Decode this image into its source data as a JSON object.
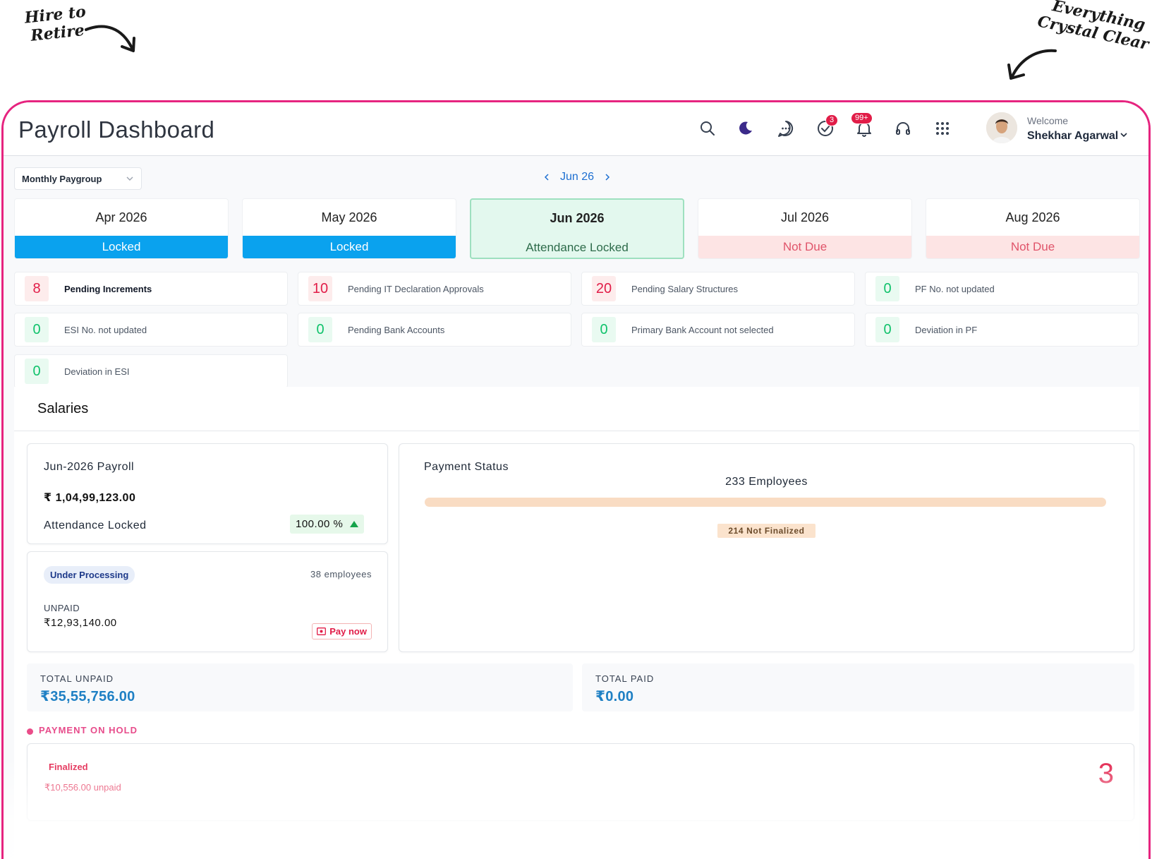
{
  "annotations": {
    "left_line1": "Hire to",
    "left_line2": "Retire",
    "right_line1": "Everything",
    "right_line2": "Crystal Clear"
  },
  "header": {
    "title": "Payroll Dashboard",
    "tasks_badge": "3",
    "notifications_badge": "99+",
    "welcome": "Welcome",
    "user_name": "Shekhar Agarwal",
    "icons": [
      "search-icon",
      "moon-icon",
      "chat-icon",
      "tasks-check-icon",
      "bell-icon",
      "headset-icon",
      "apps-grid-icon"
    ]
  },
  "controls": {
    "paygroup": "Monthly Paygroup",
    "current_month": "Jun 26"
  },
  "months": [
    {
      "name": "Apr 2026",
      "status": "Locked"
    },
    {
      "name": "May 2026",
      "status": "Locked"
    },
    {
      "name": "Jun 2026",
      "status": "Attendance Locked"
    },
    {
      "name": "Jul 2026",
      "status": "Not Due"
    },
    {
      "name": "Aug 2026",
      "status": "Not Due"
    }
  ],
  "stats": [
    {
      "value": "8",
      "label": "Pending Increments"
    },
    {
      "value": "10",
      "label": "Pending IT Declaration Approvals"
    },
    {
      "value": "20",
      "label": "Pending Salary Structures"
    },
    {
      "value": "0",
      "label": "PF No. not updated"
    },
    {
      "value": "0",
      "label": "ESI No. not updated"
    },
    {
      "value": "0",
      "label": "Pending Bank Accounts"
    },
    {
      "value": "0",
      "label": "Primary Bank Account not selected"
    },
    {
      "value": "0",
      "label": "Deviation in PF"
    },
    {
      "value": "0",
      "label": "Deviation in ESI"
    }
  ],
  "salaries": {
    "title": "Salaries",
    "payroll": {
      "title": "Jun-2026 Payroll",
      "amount": "₹ 1,04,99,123.00",
      "status": "Attendance Locked",
      "percent": "100.00 %"
    },
    "processing": {
      "pill": "Under Processing",
      "employees": "38 employees",
      "unpaid_label": "UNPAID",
      "unpaid_amount": "₹12,93,140.00",
      "pay_now": "Pay now"
    },
    "payment_status": {
      "title": "Payment Status",
      "employees": "233 Employees",
      "not_finalized": "214 Not Finalized",
      "bar_color": "#f9dcc3"
    },
    "total_unpaid": {
      "label": "TOTAL UNPAID",
      "value": "₹35,55,756.00"
    },
    "total_paid": {
      "label": "TOTAL PAID",
      "value": "₹0.00"
    },
    "on_hold": {
      "label": "PAYMENT ON HOLD",
      "finalized": "Finalized",
      "unpaid": "₹10,556.00 unpaid",
      "count": "3"
    }
  },
  "colors": {
    "frame": "#e6247f",
    "locked": "#0aa2ee",
    "active": "#e3f8ee",
    "not_due": "#fde4e4",
    "accent_blue": "#1f80c4"
  }
}
